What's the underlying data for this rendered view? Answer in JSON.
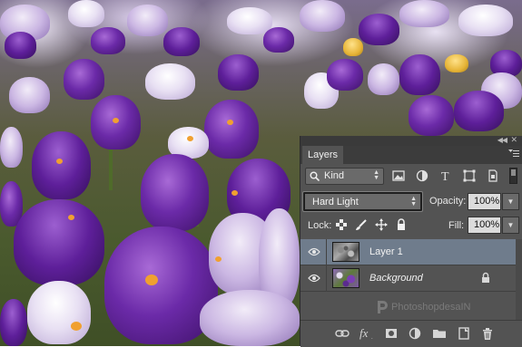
{
  "panel": {
    "tab_label": "Layers",
    "kind_filter": {
      "label": "Kind"
    },
    "blend_mode": "Hard Light",
    "opacity": {
      "label": "Opacity:",
      "value": "100%"
    },
    "lock": {
      "label": "Lock:"
    },
    "fill": {
      "label": "Fill:",
      "value": "100%"
    },
    "layers": [
      {
        "name": "Layer 1",
        "selected": true,
        "visible": true
      },
      {
        "name": "Background",
        "selected": false,
        "visible": true,
        "locked": true
      }
    ],
    "watermark_text": "PhotoshopdesaIN",
    "footer_icons": [
      "link-layers-icon",
      "fx-icon",
      "add-mask-icon",
      "adjustment-layer-icon",
      "new-group-icon",
      "new-layer-icon",
      "delete-layer-icon"
    ]
  },
  "colors": {
    "panel_bg": "#535353",
    "selected_row": "#6f7c8c",
    "tab_bar": "#3c3c3c"
  }
}
